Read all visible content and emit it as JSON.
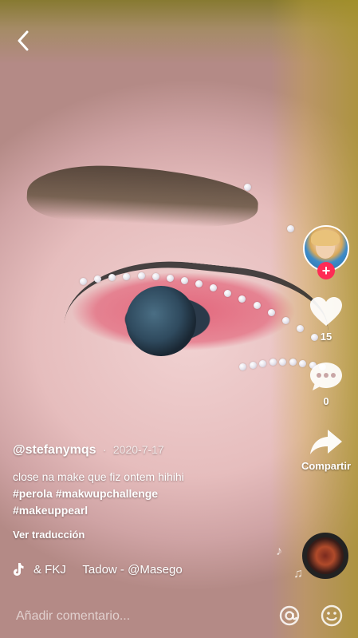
{
  "video": {
    "author": "@stefanymqs",
    "date": "2020-7-17",
    "caption": "close na make que fiz ontem hihihi",
    "hashtags": [
      "#perola",
      "#makwupchallenge",
      "#makeuppearl"
    ],
    "translate_label": "Ver traducción"
  },
  "music": {
    "icon": "tiktok-note-icon",
    "text": "& FKJ     Tadow - @Masego"
  },
  "actions": {
    "likes": "15",
    "comments": "0",
    "share_label": "Compartir"
  },
  "comment_bar": {
    "placeholder": "Añadir comentario..."
  },
  "colors": {
    "follow_plus": "#fe2c55",
    "text": "#ffffff"
  },
  "icons": {
    "back": "back-chevron-icon",
    "like": "heart-icon",
    "comment": "comment-bubble-icon",
    "share": "share-arrow-icon",
    "mention": "at-sign-icon",
    "emoji": "emoji-icon"
  }
}
